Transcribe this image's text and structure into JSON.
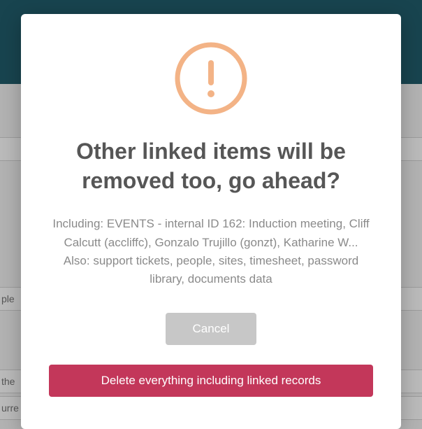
{
  "background": {
    "row1": "ple",
    "row2": "the",
    "row3": "urre"
  },
  "modal": {
    "icon": "warning-exclamation",
    "title": "Other linked items will be removed too, go ahead?",
    "desc_line1": "Including: EVENTS - internal ID 162: Induction meeting, Cliff Calcutt (accliffc), Gonzalo Trujillo (gonzt), Katharine W...",
    "desc_line2": "Also: support tickets, people, sites, timesheet, password library, documents data",
    "cancel_label": "Cancel",
    "delete_label": "Delete everything including linked records"
  }
}
